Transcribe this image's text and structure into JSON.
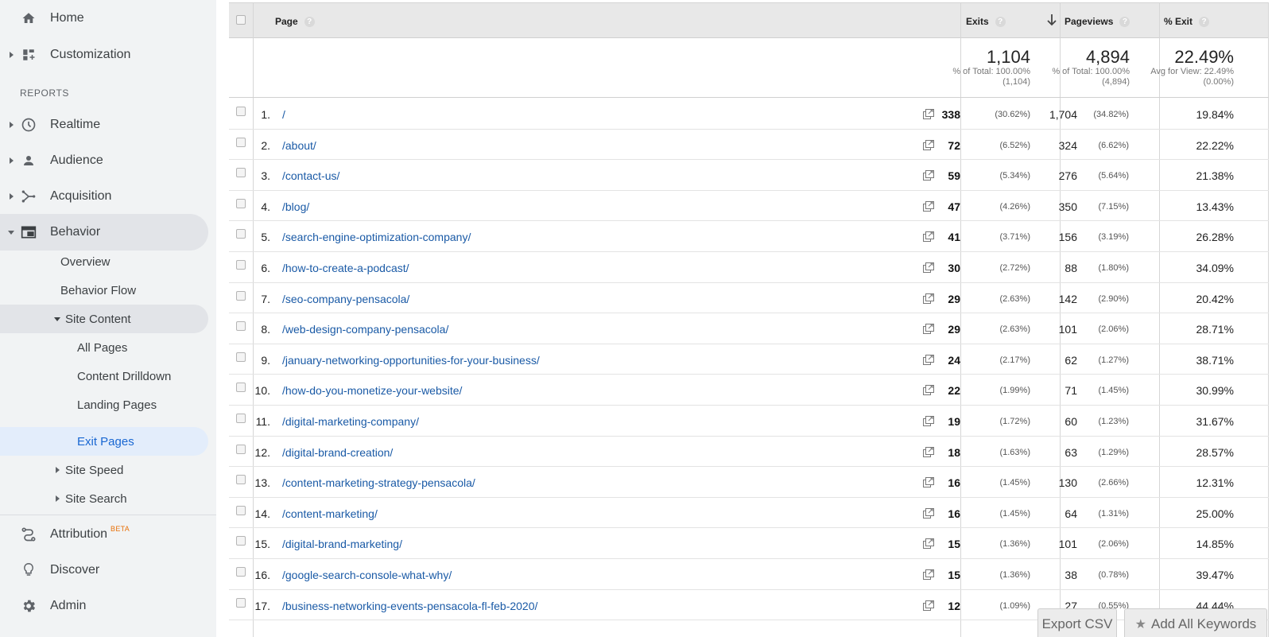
{
  "sidebar": {
    "top_items": [
      {
        "label": "Home",
        "icon": "home-icon"
      },
      {
        "label": "Customization",
        "icon": "dashboard-icon"
      }
    ],
    "reports_header": "REPORTS",
    "report_items": [
      {
        "label": "Realtime",
        "icon": "clock-icon"
      },
      {
        "label": "Audience",
        "icon": "person-icon"
      },
      {
        "label": "Acquisition",
        "icon": "acquisition-icon"
      },
      {
        "label": "Behavior",
        "icon": "behavior-icon"
      }
    ],
    "behavior_sub": [
      "Overview",
      "Behavior Flow"
    ],
    "site_content": "Site Content",
    "site_content_sub": [
      "All Pages",
      "Content Drilldown",
      "Landing Pages",
      "Exit Pages"
    ],
    "collapsed_sub": [
      "Site Speed",
      "Site Search"
    ],
    "bottom_items": [
      {
        "label": "Attribution",
        "icon": "attribution-icon",
        "badge": "BETA"
      },
      {
        "label": "Discover",
        "icon": "lightbulb-icon"
      },
      {
        "label": "Admin",
        "icon": "gear-icon"
      }
    ]
  },
  "table": {
    "headers": {
      "page": "Page",
      "exits": "Exits",
      "pageviews": "Pageviews",
      "exit_rate": "% Exit",
      "help": "?"
    },
    "summary": {
      "exits": {
        "value": "1,104",
        "line1": "% of Total: 100.00%",
        "line2": "(1,104)"
      },
      "pageviews": {
        "value": "4,894",
        "line1": "% of Total: 100.00%",
        "line2": "(4,894)"
      },
      "exit_rate": {
        "value": "22.49%",
        "line1": "Avg for View: 22.49%",
        "line2": "(0.00%)"
      }
    },
    "rows": [
      {
        "n": "1.",
        "page": "/",
        "exits": "338",
        "exits_pct": "(30.62%)",
        "pv": "1,704",
        "pv_pct": "(34.82%)",
        "rate": "19.84%"
      },
      {
        "n": "2.",
        "page": "/about/",
        "exits": "72",
        "exits_pct": "(6.52%)",
        "pv": "324",
        "pv_pct": "(6.62%)",
        "rate": "22.22%"
      },
      {
        "n": "3.",
        "page": "/contact-us/",
        "exits": "59",
        "exits_pct": "(5.34%)",
        "pv": "276",
        "pv_pct": "(5.64%)",
        "rate": "21.38%"
      },
      {
        "n": "4.",
        "page": "/blog/",
        "exits": "47",
        "exits_pct": "(4.26%)",
        "pv": "350",
        "pv_pct": "(7.15%)",
        "rate": "13.43%"
      },
      {
        "n": "5.",
        "page": "/search-engine-optimization-company/",
        "exits": "41",
        "exits_pct": "(3.71%)",
        "pv": "156",
        "pv_pct": "(3.19%)",
        "rate": "26.28%"
      },
      {
        "n": "6.",
        "page": "/how-to-create-a-podcast/",
        "exits": "30",
        "exits_pct": "(2.72%)",
        "pv": "88",
        "pv_pct": "(1.80%)",
        "rate": "34.09%"
      },
      {
        "n": "7.",
        "page": "/seo-company-pensacola/",
        "exits": "29",
        "exits_pct": "(2.63%)",
        "pv": "142",
        "pv_pct": "(2.90%)",
        "rate": "20.42%"
      },
      {
        "n": "8.",
        "page": "/web-design-company-pensacola/",
        "exits": "29",
        "exits_pct": "(2.63%)",
        "pv": "101",
        "pv_pct": "(2.06%)",
        "rate": "28.71%"
      },
      {
        "n": "9.",
        "page": "/january-networking-opportunities-for-your-business/",
        "exits": "24",
        "exits_pct": "(2.17%)",
        "pv": "62",
        "pv_pct": "(1.27%)",
        "rate": "38.71%"
      },
      {
        "n": "10.",
        "page": "/how-do-you-monetize-your-website/",
        "exits": "22",
        "exits_pct": "(1.99%)",
        "pv": "71",
        "pv_pct": "(1.45%)",
        "rate": "30.99%"
      },
      {
        "n": "11.",
        "page": "/digital-marketing-company/",
        "exits": "19",
        "exits_pct": "(1.72%)",
        "pv": "60",
        "pv_pct": "(1.23%)",
        "rate": "31.67%"
      },
      {
        "n": "12.",
        "page": "/digital-brand-creation/",
        "exits": "18",
        "exits_pct": "(1.63%)",
        "pv": "63",
        "pv_pct": "(1.29%)",
        "rate": "28.57%"
      },
      {
        "n": "13.",
        "page": "/content-marketing-strategy-pensacola/",
        "exits": "16",
        "exits_pct": "(1.45%)",
        "pv": "130",
        "pv_pct": "(2.66%)",
        "rate": "12.31%"
      },
      {
        "n": "14.",
        "page": "/content-marketing/",
        "exits": "16",
        "exits_pct": "(1.45%)",
        "pv": "64",
        "pv_pct": "(1.31%)",
        "rate": "25.00%"
      },
      {
        "n": "15.",
        "page": "/digital-brand-marketing/",
        "exits": "15",
        "exits_pct": "(1.36%)",
        "pv": "101",
        "pv_pct": "(2.06%)",
        "rate": "14.85%"
      },
      {
        "n": "16.",
        "page": "/google-search-console-what-why/",
        "exits": "15",
        "exits_pct": "(1.36%)",
        "pv": "38",
        "pv_pct": "(0.78%)",
        "rate": "39.47%"
      },
      {
        "n": "17.",
        "page": "/business-networking-events-pensacola-fl-feb-2020/",
        "exits": "12",
        "exits_pct": "(1.09%)",
        "pv": "27",
        "pv_pct": "(0.55%)",
        "rate": "44.44%"
      }
    ]
  },
  "buttons": {
    "export": "Export CSV",
    "keywords": "Add All Keywords"
  },
  "colors": {
    "link": "#1a5aa6",
    "selected_nav": "#1967d2",
    "beta": "#e8710a"
  }
}
